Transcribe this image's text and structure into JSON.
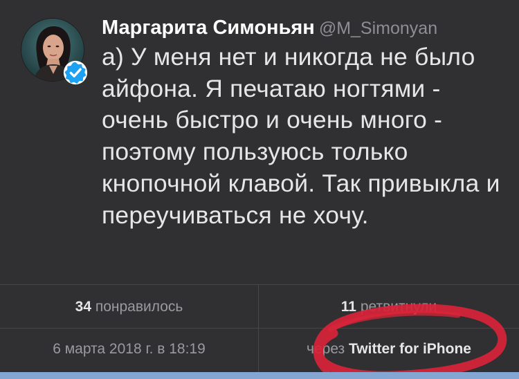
{
  "tweet": {
    "display_name": "Маргарита Симоньян",
    "handle": "@M_Simonyan",
    "text": "а) У меня нет и никогда не было айфона. Я печатаю ногтями - очень быстро и очень много - поэтому пользуюсь только кнопочной клавой. Так привыкла и переучиваться не хочу.",
    "verified": true,
    "avatar_icon": "avatar-photo",
    "verified_icon": "verified-badge-icon"
  },
  "stats": {
    "likes_count": "34",
    "likes_label": "понравилось",
    "retweets_count": "11",
    "retweets_label": "ретвитнули"
  },
  "meta": {
    "date": "6 марта 2018 г. в 18:19",
    "via_label": "через",
    "source_app": "Twitter for iPhone"
  },
  "colors": {
    "background": "#303032",
    "divider": "#47474a",
    "muted_text": "#9a9aa0",
    "verified_blue": "#1da1f2",
    "annotation_red": "#d9243a",
    "bottom_bar": "#84a6d2"
  }
}
